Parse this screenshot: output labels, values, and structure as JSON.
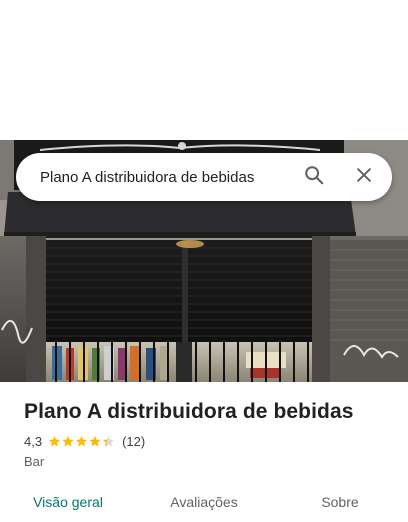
{
  "search": {
    "query": "Plano A distribuidora de bebidas",
    "search_icon": "search-icon",
    "close_icon": "close-icon"
  },
  "place": {
    "name": "Plano A distribuidora de bebidas",
    "rating": "4,3",
    "stars": 4.3,
    "review_count": "(12)",
    "category": "Bar"
  },
  "tabs": [
    {
      "label": "Visão geral",
      "active": true
    },
    {
      "label": "Avaliações",
      "active": false
    },
    {
      "label": "Sobre",
      "active": false
    }
  ],
  "colors": {
    "accent": "#00796b",
    "star": "#fbbc04",
    "text": "#202124"
  }
}
